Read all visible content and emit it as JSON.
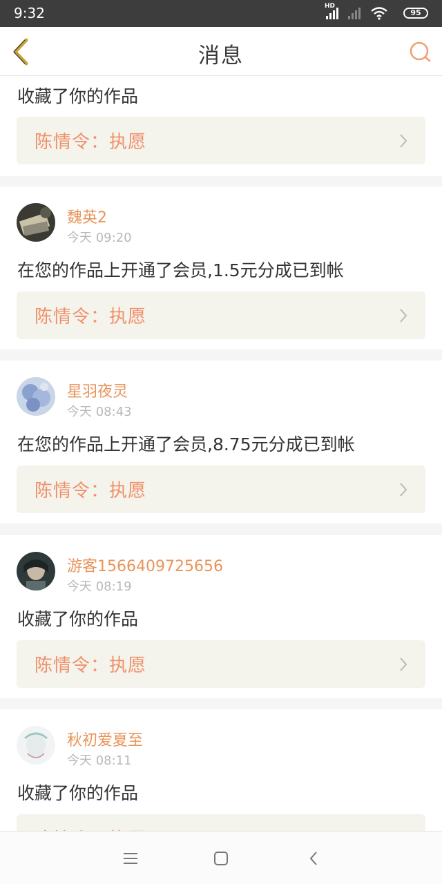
{
  "status_bar": {
    "time": "9:32",
    "network_label": "HD",
    "battery": "95"
  },
  "header": {
    "title": "消息",
    "back_icon": "chevron-left-icon",
    "search_icon": "search-icon"
  },
  "messages": [
    {
      "user": "",
      "time": "",
      "text": "收藏了你的作品",
      "work": "陈情令：执愿"
    },
    {
      "user": "魏英2",
      "time": "今天 09:20",
      "text": "在您的作品上开通了会员,1.5元分成已到帐",
      "work": "陈情令：执愿"
    },
    {
      "user": "星羽夜灵",
      "time": "今天 08:43",
      "text": "在您的作品上开通了会员,8.75元分成已到帐",
      "work": "陈情令：执愿"
    },
    {
      "user": "游客1566409725656",
      "time": "今天 08:19",
      "text": "收藏了你的作品",
      "work": "陈情令：执愿"
    },
    {
      "user": "秋初爱夏至",
      "time": "今天 08:11",
      "text": "收藏了你的作品",
      "work": "陈情令：执愿"
    }
  ],
  "colors": {
    "accent": "#e8945a",
    "work_bg": "#f4f3ec",
    "back_icon": "#c9a43a"
  },
  "nav": {
    "menu_icon": "menu-icon",
    "home_icon": "home-icon",
    "back_icon": "back-icon"
  }
}
